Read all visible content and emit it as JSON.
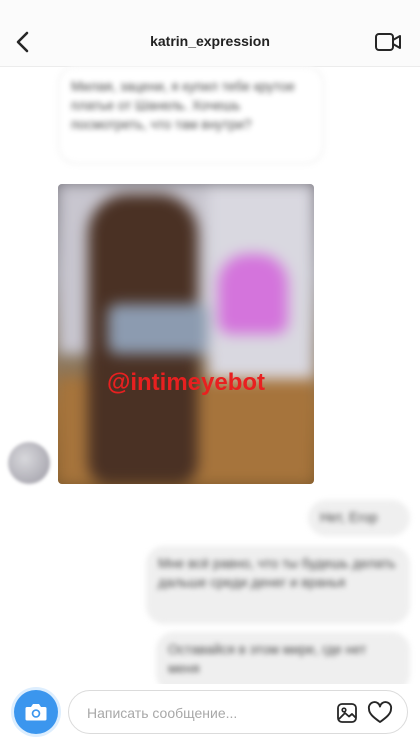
{
  "header": {
    "username": "katrin_expression",
    "back_icon": "chevron-left-icon",
    "video_icon": "video-call-icon"
  },
  "messages": [
    {
      "direction": "incoming",
      "type": "text",
      "text": "Милая, зацени, я купил тебе крутое платье от Шанель. Хочешь посмотреть, что там внутри?"
    },
    {
      "direction": "incoming",
      "type": "image",
      "watermark": "@intimeyebot"
    },
    {
      "direction": "outgoing",
      "type": "text",
      "text": "Нет, Егор"
    },
    {
      "direction": "outgoing",
      "type": "text",
      "text": "Мне всё равно, что ты будешь делать дальше среди денег и вранья"
    },
    {
      "direction": "outgoing",
      "type": "text",
      "text": "Оставайся в этом мире, где нет меня"
    }
  ],
  "composer": {
    "placeholder": "Написать сообщение...",
    "camera_icon": "camera-icon",
    "gallery_icon": "gallery-icon",
    "like_icon": "heart-icon"
  },
  "colors": {
    "accent": "#3b96ee",
    "watermark": "#e82020",
    "outgoing_bubble": "#efefef"
  }
}
